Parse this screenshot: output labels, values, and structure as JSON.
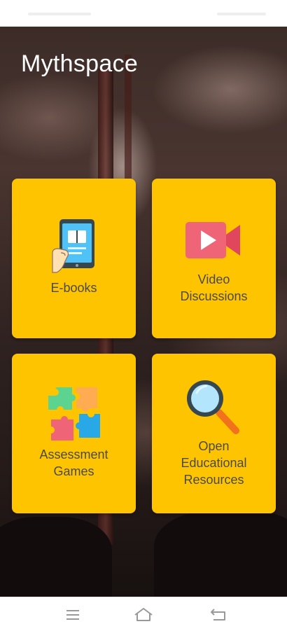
{
  "app": {
    "title": "Mythspace"
  },
  "tiles": [
    {
      "label": "E-books",
      "icon": "ebook-tablet-icon"
    },
    {
      "label": "Video\nDiscussions",
      "icon": "video-camera-icon"
    },
    {
      "label": "Assessment\nGames",
      "icon": "puzzle-pieces-icon"
    },
    {
      "label": "Open\nEducational\nResources",
      "icon": "magnifying-glass-icon"
    }
  ],
  "nav": {
    "buttons": [
      "menu-icon",
      "home-icon",
      "back-icon"
    ]
  },
  "colors": {
    "tile": "#ffc400",
    "title": "#ffffff",
    "label": "#4a4a4a"
  }
}
